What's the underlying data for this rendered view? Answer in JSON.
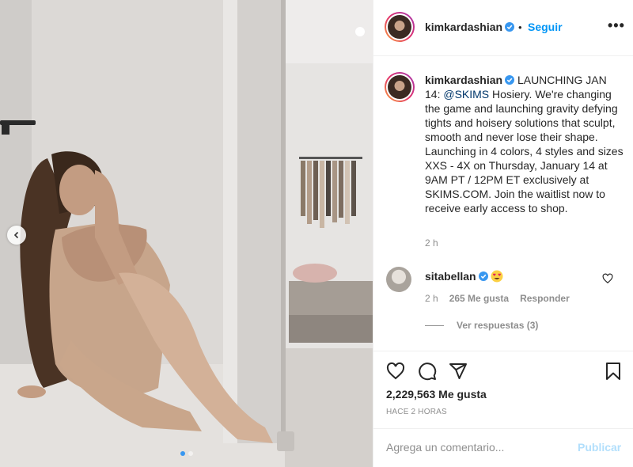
{
  "header": {
    "username": "kimkardashian",
    "separator": "•",
    "follow_label": "Seguir",
    "more_label": "•••"
  },
  "caption": {
    "username": "kimkardashian",
    "text_before": " LAUNCHING JAN 14: ",
    "mention": "@SKIMS",
    "text_after": " Hosiery. We're changing the game and launching gravity defying tights and hoisery solutions that sculpt, smooth and never lose their shape. Launching in 4 colors, 4 styles and sizes XXS - 4X on Thursday, January 14 at 9AM PT / 12PM ET exclusively at SKIMS.COM. Join the waitlist now to receive early access to shop.",
    "time": "2 h"
  },
  "comment": {
    "username": "sitabellan",
    "time": "2 h",
    "likes": "265 Me gusta",
    "reply_label": "Responder",
    "view_replies": "Ver respuestas (3)"
  },
  "post": {
    "likes": "2,229,563 Me gusta",
    "time": "HACE 2 HORAS"
  },
  "add_comment": {
    "placeholder": "Agrega un comentario...",
    "publish_label": "Publicar"
  },
  "carousel": {
    "slide_count": 2,
    "active_index": 0
  },
  "icons": {
    "verified": "verified-badge-icon",
    "heart": "heart-icon",
    "comment": "comment-icon",
    "share": "share-icon",
    "save": "bookmark-icon",
    "prev": "chevron-left-icon",
    "emoji": "heart-eyes-emoji-icon"
  },
  "colors": {
    "accent": "#0095f6",
    "verified": "#3897f0",
    "muted": "#8e8e8e",
    "publish_disabled": "#b2dffc",
    "text": "#262626"
  }
}
